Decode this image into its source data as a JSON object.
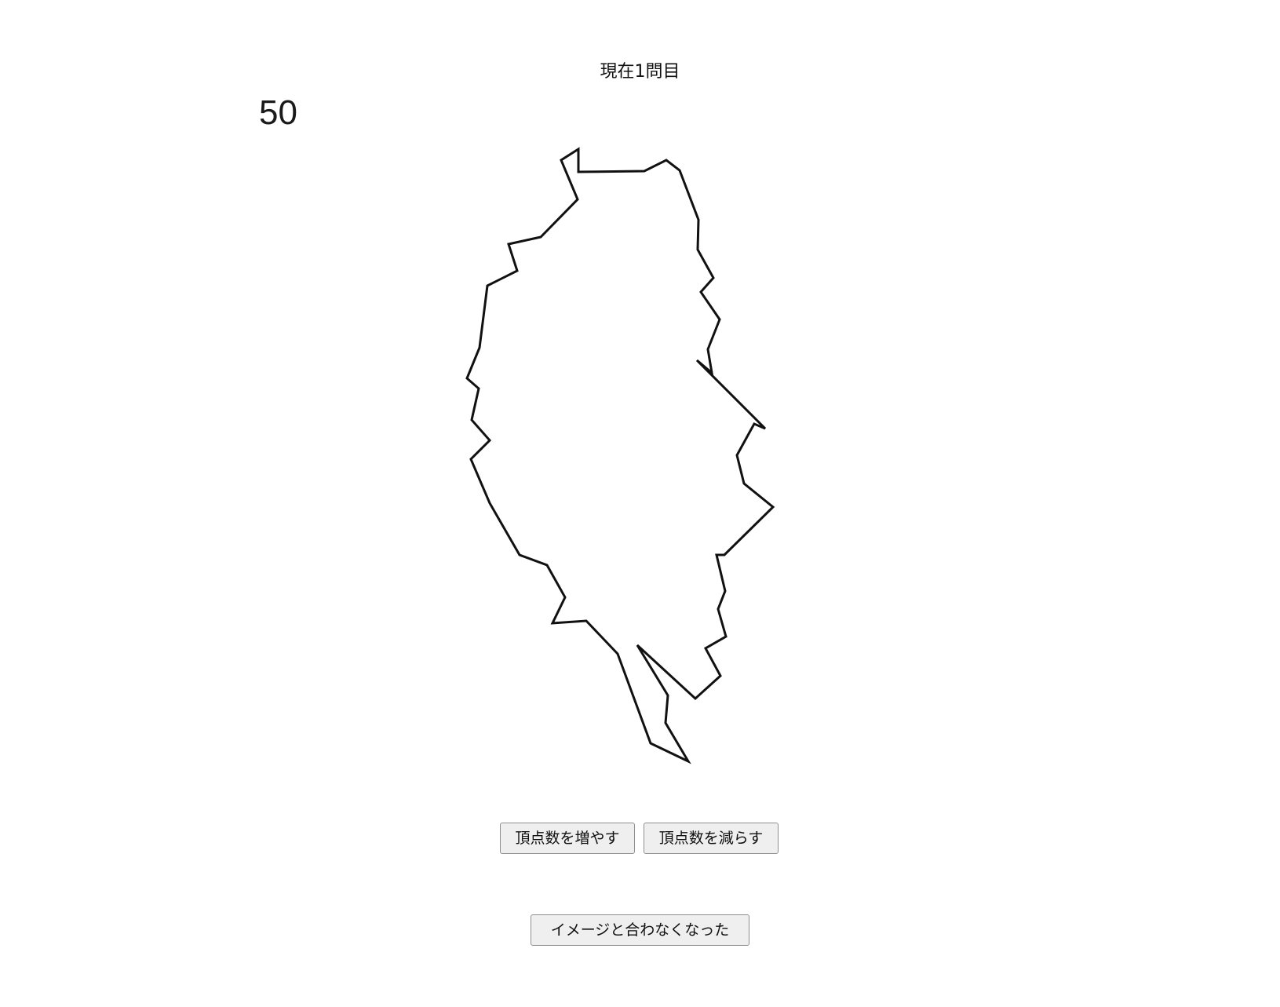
{
  "header": {
    "question_label": "現在1問目"
  },
  "vertex_count": "50",
  "buttons": {
    "increase_vertices": "頂点数を増やす",
    "decrease_vertices": "頂点数を減らす",
    "mismatch": "イメージと合わなくなった"
  }
}
